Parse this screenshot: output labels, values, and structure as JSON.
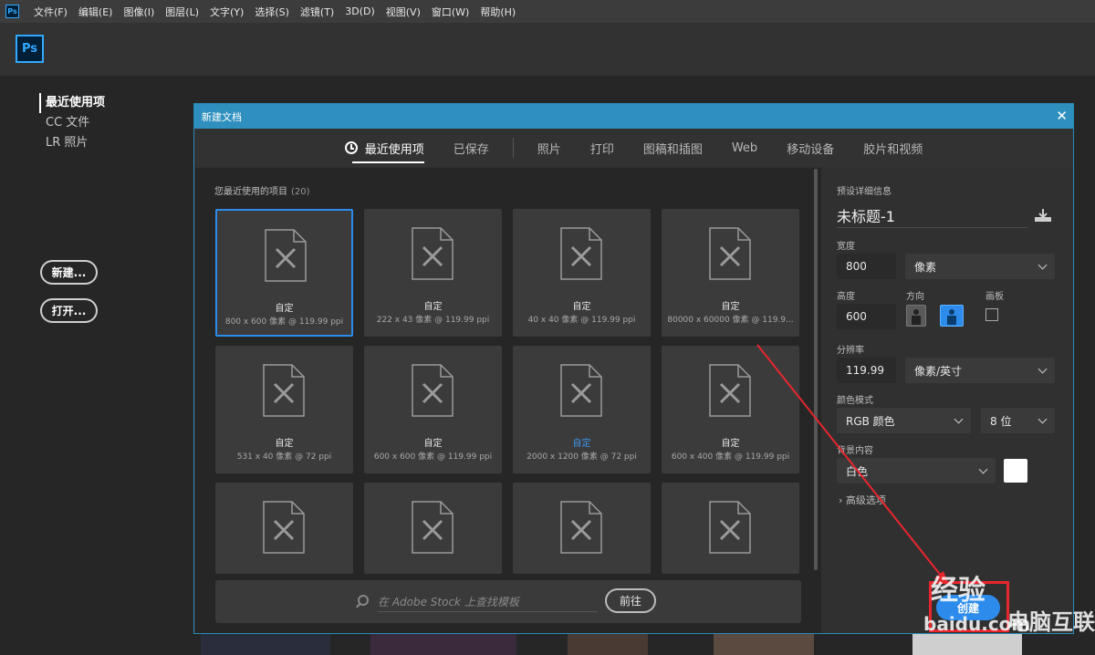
{
  "menubar": {
    "app_icon_label": "Ps",
    "items": [
      "文件(F)",
      "编辑(E)",
      "图像(I)",
      "图层(L)",
      "文字(Y)",
      "选择(S)",
      "滤镜(T)",
      "3D(D)",
      "视图(V)",
      "窗口(W)",
      "帮助(H)"
    ]
  },
  "appbar": {
    "logo_label": "Ps"
  },
  "home": {
    "nav": [
      "最近使用项",
      "CC 文件",
      "LR 照片"
    ],
    "new_button": "新建...",
    "open_button": "打开..."
  },
  "dialog": {
    "title": "新建文档",
    "close_label": "✕",
    "tabs": [
      "最近使用项",
      "已保存",
      "照片",
      "打印",
      "图稿和插图",
      "Web",
      "移动设备",
      "胶片和视频"
    ],
    "recent": {
      "title": "您最近使用的项目",
      "count": "(20)",
      "tiles": [
        {
          "name": "自定",
          "size": "800 x 600 像素 @ 119.99 ppi"
        },
        {
          "name": "自定",
          "size": "222 x 43 像素 @ 119.99 ppi"
        },
        {
          "name": "自定",
          "size": "40 x 40 像素 @ 119.99 ppi"
        },
        {
          "name": "自定",
          "size": "80000 x 60000 像素 @ 119.9..."
        },
        {
          "name": "自定",
          "size": "531 x 40 像素 @ 72 ppi"
        },
        {
          "name": "自定",
          "size": "600 x 600 像素 @ 119.99 ppi"
        },
        {
          "name": "自定",
          "size": "2000 x 1200 像素 @ 72 ppi"
        },
        {
          "name": "自定",
          "size": "600 x 400 像素 @ 119.99 ppi"
        },
        {
          "name": "",
          "size": ""
        },
        {
          "name": "",
          "size": ""
        },
        {
          "name": "",
          "size": ""
        },
        {
          "name": "",
          "size": ""
        }
      ]
    },
    "search": {
      "placeholder": "在 Adobe Stock 上查找模板",
      "go_button": "前往"
    },
    "details": {
      "section_label": "预设详细信息",
      "preset_name": "未标题-1",
      "width_label": "宽度",
      "width_value": "800",
      "width_unit": "像素",
      "height_label": "高度",
      "height_value": "600",
      "orientation_label": "方向",
      "artboard_label": "画板",
      "resolution_label": "分辨率",
      "resolution_value": "119.99",
      "resolution_unit": "像素/英寸",
      "color_mode_label": "颜色模式",
      "color_mode_value": "RGB 颜色",
      "bit_depth": "8 位",
      "background_label": "背景内容",
      "background_value": "白色",
      "advanced_label": "高级选项",
      "create_button": "创建"
    }
  },
  "watermark": {
    "line1": "经验",
    "line2": "baidu.com",
    "line3": "电脑互联"
  },
  "colors": {
    "accent": "#2d8ceb",
    "title_bar": "#2f90bf",
    "annotation": "#e8262e"
  }
}
